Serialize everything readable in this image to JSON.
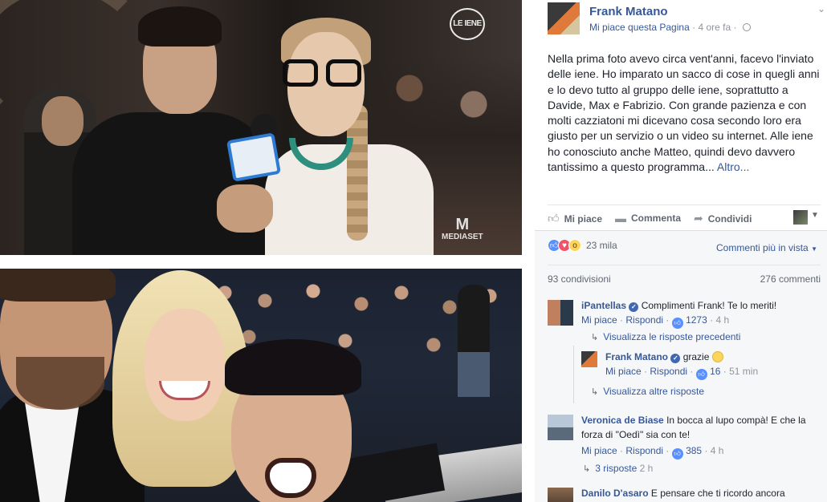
{
  "post": {
    "page_name": "Frank Matano",
    "like_page": "Mi piace questa Pagina",
    "time": "4 ore fa",
    "separator": "·",
    "text": "Nella prima foto avevo circa vent'anni, facevo l'inviato delle iene. Ho imparato un sacco di cose in quegli anni e lo devo tutto al gruppo delle iene, soprattutto a Davide, Max e Fabrizio. Con grande pazienza e con molti cazziatoni mi dicevano cosa secondo loro era giusto per un servizio o un video su internet. Alle iene ho conosciuto anche Matteo, quindi devo davvero tantissimo a questo programma...",
    "more": "Altro..."
  },
  "photo_logos": {
    "iene": "LE IENE",
    "mediaset_mark": "M",
    "mediaset": "MEDIASET"
  },
  "actions": {
    "like": "Mi piace",
    "comment": "Commenta",
    "share": "Condividi"
  },
  "stats": {
    "reactions": "23 mila",
    "sort": "Commenti più in vista",
    "shares": "93 condivisioni",
    "comments": "276 commenti"
  },
  "comments": [
    {
      "name": "iPantellas",
      "text": "Complimenti Frank! Te lo meriti!",
      "like_label": "Mi piace",
      "reply_label": "Rispondi",
      "likes": "1273",
      "time": "4 h"
    },
    {
      "name": "Frank Matano",
      "text": "grazie",
      "like_label": "Mi piace",
      "reply_label": "Rispondi",
      "likes": "16",
      "time": "51 min"
    },
    {
      "name": "Veronica de Biase",
      "text": "In bocca al lupo compà! E che la forza di \"Oedì\" sia con te!",
      "like_label": "Mi piace",
      "reply_label": "Rispondi",
      "likes": "385",
      "time": "4 h"
    },
    {
      "name": "Danilo D'asaro",
      "text": "E pensare che ti ricordo ancora"
    }
  ],
  "reply_links": {
    "previous": "Visualizza le risposte precedenti",
    "more": "Visualizza altre risposte",
    "three": "3 risposte",
    "three_time": "2 h"
  },
  "colors": {
    "link": "#365899",
    "text": "#1d2129",
    "muted": "#90949c",
    "like_blue": "#5890ff",
    "love_red": "#f25268"
  }
}
